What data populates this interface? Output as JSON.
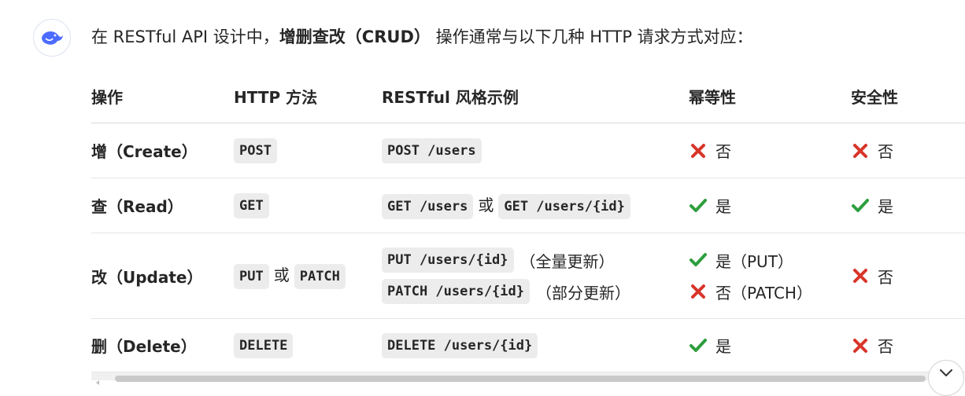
{
  "intro": {
    "prefix": "在 RESTful API 设计中，",
    "bold": "增删查改（CRUD）",
    "suffix": " 操作通常与以下几种 HTTP 请求方式对应："
  },
  "table": {
    "headers": [
      "操作",
      "HTTP 方法",
      "RESTful 风格示例",
      "幂等性",
      "安全性"
    ],
    "rows": [
      {
        "op": "增（Create）",
        "methods": [
          "POST"
        ],
        "method_connector": "",
        "examples": [
          {
            "code": "POST /users",
            "note": ""
          }
        ],
        "example_connector": "",
        "extra_code": "",
        "idempotent": [
          {
            "mark": "no",
            "text": "否"
          }
        ],
        "safe": [
          {
            "mark": "no",
            "text": "否"
          }
        ]
      },
      {
        "op": "查（Read）",
        "methods": [
          "GET"
        ],
        "method_connector": "",
        "examples": [
          {
            "code": "GET /users",
            "note": ""
          }
        ],
        "example_connector": "或",
        "extra_code": "GET /users/{id}",
        "idempotent": [
          {
            "mark": "yes",
            "text": "是"
          }
        ],
        "safe": [
          {
            "mark": "yes",
            "text": "是"
          }
        ]
      },
      {
        "op": "改（Update）",
        "methods": [
          "PUT",
          "PATCH"
        ],
        "method_connector": "或",
        "examples": [
          {
            "code": "PUT /users/{id}",
            "note": "（全量更新）"
          },
          {
            "code": "PATCH /users/{id}",
            "note": "（部分更新）"
          }
        ],
        "example_connector": "",
        "extra_code": "",
        "idempotent": [
          {
            "mark": "yes",
            "text": "是（PUT）"
          },
          {
            "mark": "no",
            "text": "否（PATCH）"
          }
        ],
        "safe": [
          {
            "mark": "no",
            "text": "否"
          }
        ]
      },
      {
        "op": "删（Delete）",
        "methods": [
          "DELETE"
        ],
        "method_connector": "",
        "examples": [
          {
            "code": "DELETE /users/{id}",
            "note": ""
          }
        ],
        "example_connector": "",
        "extra_code": "",
        "idempotent": [
          {
            "mark": "yes",
            "text": "是"
          }
        ],
        "safe": [
          {
            "mark": "no",
            "text": "否"
          }
        ]
      }
    ]
  },
  "colors": {
    "yes_mark": "#2e9e3e",
    "no_mark": "#d8352a",
    "code_bg": "#ececec",
    "avatar_brand": "#4d6bfe"
  },
  "icons": {
    "avatar": "deepseek-whale-icon",
    "yes": "check-mark-icon",
    "no": "cross-mark-icon",
    "scroll": "chevron-down-icon"
  }
}
